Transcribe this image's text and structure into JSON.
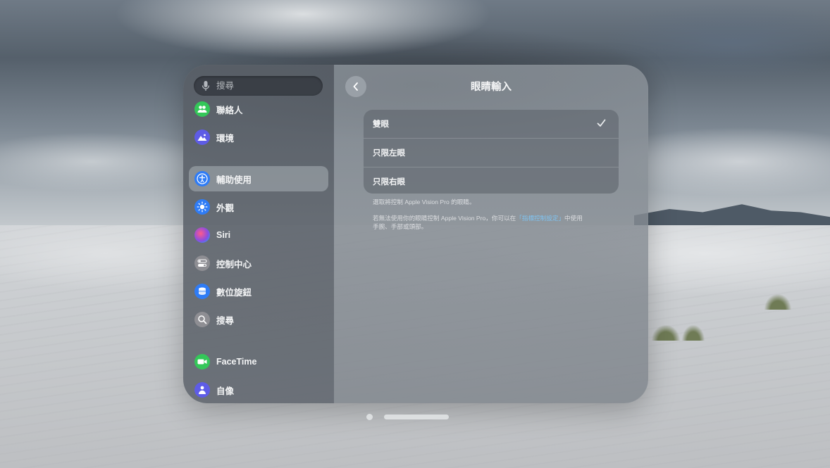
{
  "colors": {
    "accent_link": "#7fc4f2",
    "contacts_icon": "#34c759",
    "environments_icon": "#5e5ce6",
    "accessibility_icon": "#2f7cf6",
    "appearance_icon": "#2f7cf6",
    "siri_icon": "#8a4de0",
    "control_center_icon": "#8e8e93",
    "digital_crown_icon": "#2f7cf6",
    "search_icon_bg": "#8e8e93",
    "facetime_icon": "#34c759",
    "persona_icon": "#5e5ce6"
  },
  "sidebar": {
    "search": {
      "placeholder": "搜尋",
      "value": ""
    },
    "items": [
      {
        "label": "聯絡人",
        "icon": "contacts-icon"
      },
      {
        "label": "環境",
        "icon": "environments-icon"
      },
      {
        "label": "輔助使用",
        "icon": "accessibility-icon",
        "selected": true
      },
      {
        "label": "外觀",
        "icon": "appearance-icon"
      },
      {
        "label": "Siri",
        "icon": "siri-icon"
      },
      {
        "label": "控制中心",
        "icon": "control-center-icon"
      },
      {
        "label": "數位旋鈕",
        "icon": "digital-crown-icon"
      },
      {
        "label": "搜尋",
        "icon": "search-icon"
      },
      {
        "label": "FaceTime",
        "icon": "facetime-icon"
      },
      {
        "label": "自像",
        "icon": "persona-icon"
      }
    ]
  },
  "main": {
    "title": "眼睛輸入",
    "options": [
      {
        "label": "雙眼",
        "selected": true
      },
      {
        "label": "只限左眼",
        "selected": false
      },
      {
        "label": "只限右眼",
        "selected": false
      }
    ],
    "footer": "選取將控制 Apple Vision Pro 的眼睛。",
    "note": {
      "prefix": "若無法使用你的眼睛控制 Apple Vision Pro，你可以在",
      "link": "「指標控制設定」",
      "suffix_line1": "中使用",
      "line2": "手腕、手部或頭部。"
    }
  }
}
